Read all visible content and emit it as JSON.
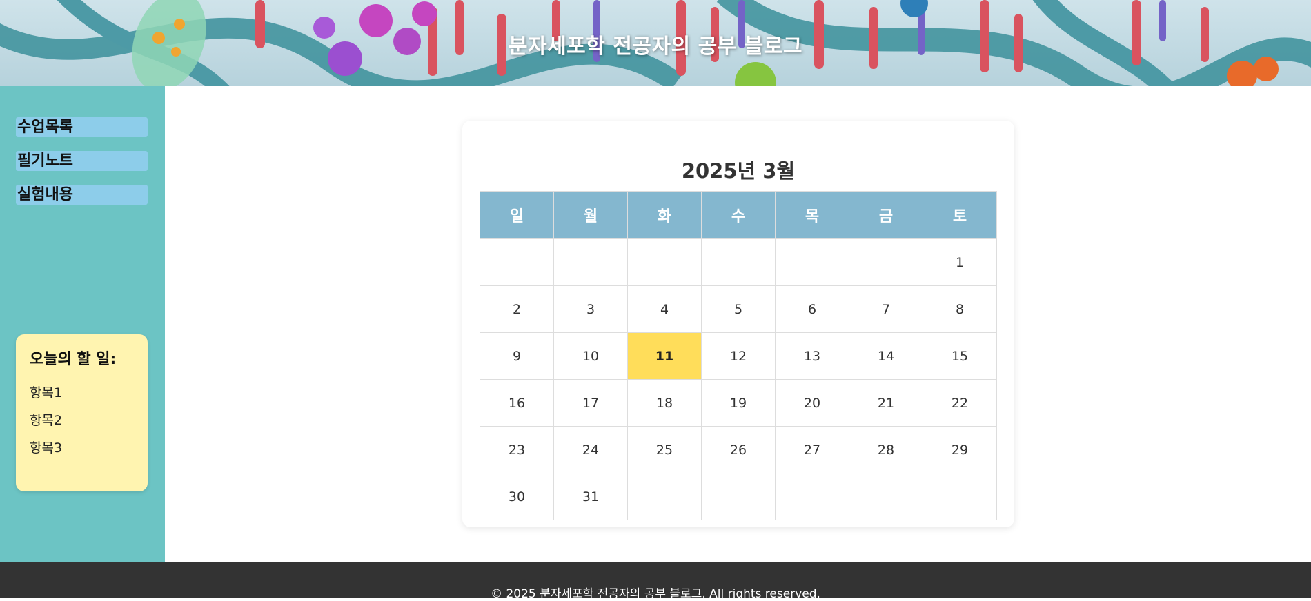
{
  "header": {
    "title": "분자세포학 전공자의 공부 블로그"
  },
  "sidebar": {
    "nav": [
      {
        "label": "수업목록"
      },
      {
        "label": "필기노트"
      },
      {
        "label": "실험내용"
      }
    ],
    "todo": {
      "title": "오늘의 할 일:",
      "items": [
        "항목1",
        "항목2",
        "항목3"
      ]
    }
  },
  "calendar": {
    "title": "2025년 3월",
    "weekdays": [
      "일",
      "월",
      "화",
      "수",
      "목",
      "금",
      "토"
    ],
    "weeks": [
      [
        "",
        "",
        "",
        "",
        "",
        "",
        "1"
      ],
      [
        "2",
        "3",
        "4",
        "5",
        "6",
        "7",
        "8"
      ],
      [
        "9",
        "10",
        "11",
        "12",
        "13",
        "14",
        "15"
      ],
      [
        "16",
        "17",
        "18",
        "19",
        "20",
        "21",
        "22"
      ],
      [
        "23",
        "24",
        "25",
        "26",
        "27",
        "28",
        "29"
      ],
      [
        "30",
        "31",
        "",
        "",
        "",
        "",
        ""
      ]
    ],
    "today": "11"
  },
  "footer": {
    "text": "© 2025 분자세포학 전공자의 공부 블로그. All rights reserved."
  },
  "colors": {
    "header_overlay_text": "#ffffff",
    "sidebar_bg": "#6cc4c4",
    "nav_item_bg": "#8dcdea",
    "todo_bg": "#fff4b0",
    "weekday_header_bg": "#84b7cf",
    "today_highlight": "#ffdd5a",
    "footer_bg": "#333333"
  }
}
